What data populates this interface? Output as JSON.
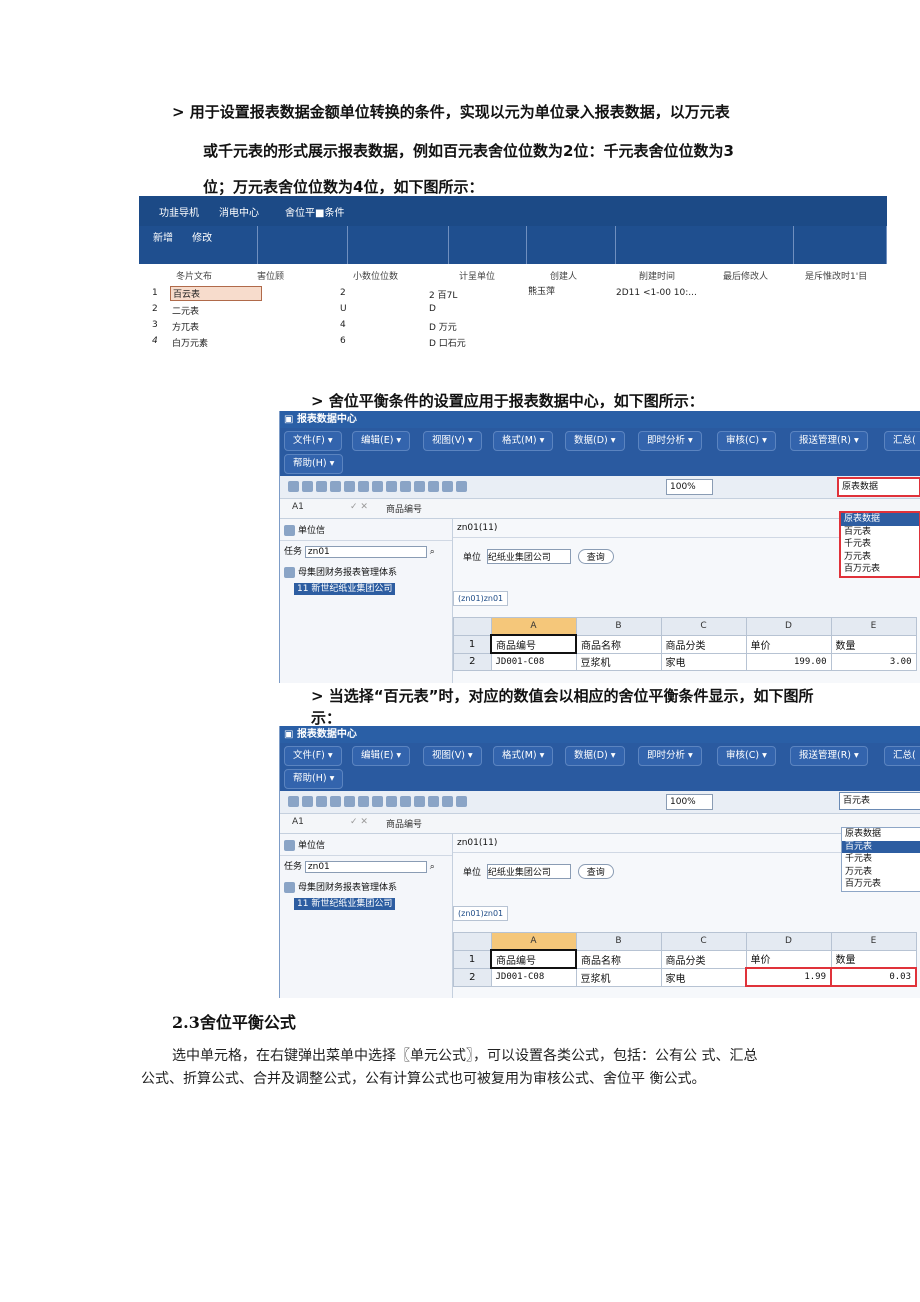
{
  "intro": {
    "line1": "> 用于设置报表数据金额单位转换的条件，实现以元为单位录入报表数据，以万元表",
    "line2": "或千元表的形式展示报表数据，例如百元表舍位位数为2位：千元表舍位位数为3",
    "line3": "位；万元表舍位位数为4位，如下图所示："
  },
  "shot1": {
    "nav": [
      "功韭导机",
      "消电中心",
      "舍位平■条件"
    ],
    "buttons": [
      "新增",
      "修改"
    ],
    "headers": [
      "冬片文布",
      "害位顾",
      "小数位位数",
      "计呈单位",
      "创建人",
      "削建时间",
      "最后修改人",
      "是斥惟改时1'目"
    ],
    "rows": [
      {
        "num": "1",
        "name": "百云表",
        "digits": "2",
        "unit": "2 百7L",
        "creator": "熊玉萍",
        "created": "2D11 <1-00 10:..."
      },
      {
        "num": "2",
        "name": "二元表",
        "digits": "U",
        "unit": "D",
        "creator": "",
        "created": ""
      },
      {
        "num": "3",
        "name": "方兀表",
        "digits": "4",
        "unit": "D 万元",
        "creator": "",
        "created": ""
      },
      {
        "num": "4",
        "name": "白万元素",
        "digits": "6",
        "unit": "D 口石元",
        "creator": "",
        "created": ""
      }
    ]
  },
  "caption2": "> 舍位平衡条件的设置应用于报表数据中心，如下图所示：",
  "caption3a": "> 当选择“百元表”时，对应的数值会以相应的舍位平衡条件显示，如下图所",
  "caption3b": "示：",
  "win": {
    "title": "报表数据中心",
    "menus": [
      "文件(F) ▾",
      "编辑(E) ▾",
      "视图(V) ▾",
      "格式(M) ▾",
      "数据(D) ▾",
      "即时分析 ▾",
      "审核(C) ▾",
      "报送管理(R) ▾",
      "汇总(",
      "帮助(H) ▾"
    ],
    "zoom": "100%",
    "cellref": "A1",
    "formula": "商品编号",
    "panel_title": "单位信",
    "task_label": "任务",
    "task_value": "zn01",
    "tree_root": "母集团财务报表管理体系",
    "tree_child": "11 新世纪纸业集团公司",
    "doc_tab": "zn01(11)",
    "unit_label": "单位",
    "unit_value": "纪纸业集团公司",
    "query": "查询",
    "sheet_tab": "(zn01)zn01",
    "cols": [
      "A",
      "B",
      "C",
      "D",
      "E"
    ],
    "row1": [
      "商品编号",
      "商品名称",
      "商品分类",
      "单价",
      "数量"
    ],
    "row2_code": "JD001-C08",
    "row2_name": "豆浆机",
    "row2_cat": "家电",
    "options": [
      "原表数据",
      "百元表",
      "千元表",
      "万元表",
      "百万元表"
    ]
  },
  "win1": {
    "selected": "原表数据",
    "d": "199.00",
    "e": "3.00"
  },
  "win2": {
    "selected": "百元表",
    "d": "1.99",
    "e": "0.03"
  },
  "section": {
    "heading": "2.3舍位平衡公式",
    "text1": "选中单元格，在右键弹出菜单中选择〖单元公式〗，可以设置各类公式，包括：公有公 式、汇总",
    "text2": "公式、折算公式、合并及调整公式，公有计算公式也可被复用为审核公式、舍位平 衡公式。"
  }
}
